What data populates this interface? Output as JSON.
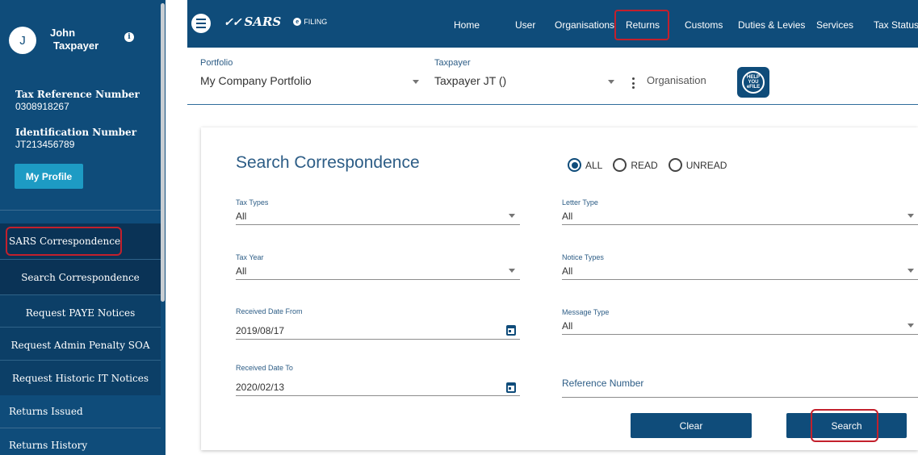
{
  "user": {
    "avatar_letter": "J",
    "first_name": "John",
    "last_name": "Taxpayer",
    "tax_ref_label": "Tax Reference Number",
    "tax_ref_value": "0308918267",
    "id_label": "Identification Number",
    "id_value": "JT213456789",
    "profile_button": "My Profile"
  },
  "sidebar": {
    "section": "SARS Correspondence",
    "sub_items": [
      "Search Correspondence",
      "Request PAYE Notices",
      "Request Admin Penalty SOA",
      "Request Historic IT Notices"
    ],
    "items_after": [
      "Returns Issued",
      "Returns History"
    ]
  },
  "header": {
    "logo_text": "SARS",
    "filing_text": "FILING",
    "nav": [
      "Home",
      "User",
      "Organisations",
      "Returns",
      "Customs",
      "Duties & Levies",
      "Services",
      "Tax Status"
    ]
  },
  "toolbar": {
    "portfolio_label": "Portfolio",
    "portfolio_value": "My Company Portfolio",
    "taxpayer_label": "Taxpayer",
    "taxpayer_value": "Taxpayer JT ()",
    "organisation": "Organisation",
    "help": [
      "HELP",
      "YOU",
      "eFILE"
    ]
  },
  "search": {
    "title": "Search Correspondence",
    "filters": {
      "all": "ALL",
      "read": "READ",
      "unread": "UNREAD",
      "selected": "ALL"
    },
    "fields": {
      "tax_types_label": "Tax Types",
      "tax_types_value": "All",
      "letter_type_label": "Letter Type",
      "letter_type_value": "All",
      "tax_year_label": "Tax Year",
      "tax_year_value": "All",
      "notice_types_label": "Notice Types",
      "notice_types_value": "All",
      "date_from_label": "Received Date From",
      "date_from_value": "2019/08/17",
      "message_type_label": "Message Type",
      "message_type_value": "All",
      "date_to_label": "Received Date To",
      "date_to_value": "2020/02/13",
      "reference_label": "Reference Number"
    },
    "clear_button": "Clear",
    "search_button": "Search"
  },
  "colors": {
    "brand": "#0f4c7a",
    "accent": "#1d9bc4",
    "highlight": "#c3202c"
  }
}
